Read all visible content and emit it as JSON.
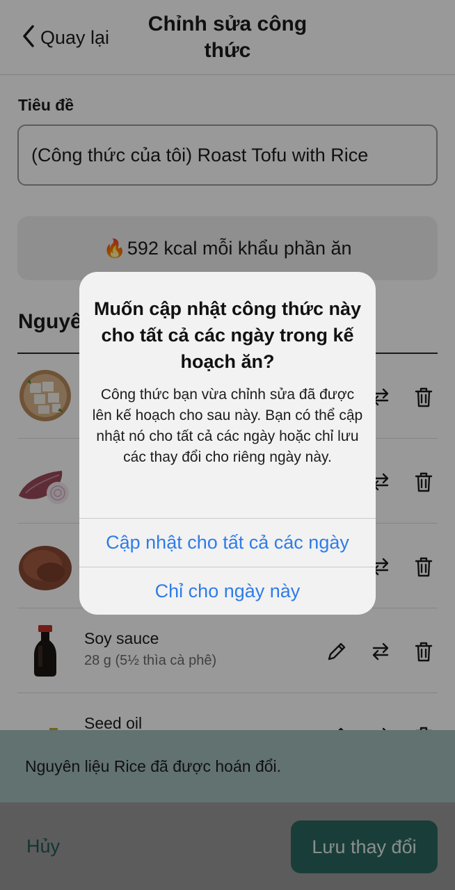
{
  "header": {
    "back_label": "Quay lại",
    "title": "Chỉnh sửa công thức"
  },
  "form": {
    "title_label": "Tiêu đề",
    "title_value": "(Công thức của tôi) Roast Tofu with Rice",
    "kcal_text": "592 kcal mỗi khẩu phần ăn",
    "section_title": "Nguyên liệu"
  },
  "ingredients": [
    {
      "name": "",
      "qty": "",
      "thumb": "tofu-icon"
    },
    {
      "name": "",
      "qty": "",
      "thumb": "shallot-icon"
    },
    {
      "name": "",
      "qty": "",
      "thumb": "rice-icon"
    },
    {
      "name": "Soy sauce",
      "qty": "28 g (5½ thìa cà phê)",
      "thumb": "soy-sauce-bottle-icon"
    },
    {
      "name": "Seed oil",
      "qty": "",
      "thumb": "oil-bottle-icon"
    }
  ],
  "dialog": {
    "title": "Muốn cập nhật công thức này cho tất cả các ngày trong kế hoạch ăn?",
    "message": "Công thức bạn vừa chỉnh sửa đã được lên kế hoạch cho sau này. Bạn có thể cập nhật nó cho tất cả các ngày hoặc chỉ lưu các thay đổi cho riêng ngày này.",
    "update_all_label": "Cập nhật cho tất cả các ngày",
    "this_day_label": "Chỉ cho ngày này"
  },
  "snackbar": {
    "text": "Nguyên liệu Rice đã được hoán đổi."
  },
  "bottom": {
    "cancel_label": "Hủy",
    "save_label": "Lưu thay đổi"
  },
  "colors": {
    "accent_green": "#2b6860",
    "link_blue": "#2f7ce8",
    "snackbar_bg": "#a4bfbb"
  }
}
